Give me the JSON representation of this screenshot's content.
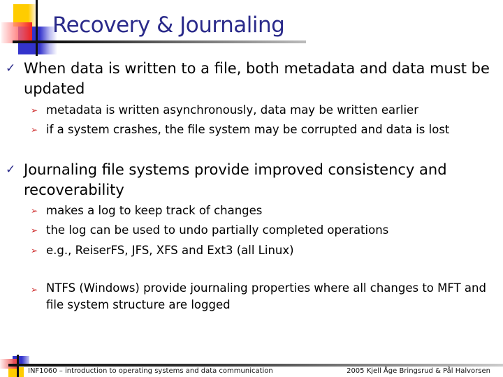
{
  "slide": {
    "title": "Recovery & Journaling",
    "bullets": [
      {
        "text": "When data is written to a file, both metadata and data must be updated",
        "sub": [
          "metadata is written asynchronously, data may be written earlier",
          "if a system crashes, the file system may be corrupted and data is lost"
        ]
      },
      {
        "text": "Journaling file systems provide improved consistency and recoverability",
        "sub": [
          "makes a log to keep track of changes",
          "the log can be used to undo partially completed operations",
          "e.g., ReiserFS, JFS, XFS and Ext3 (all Linux)",
          "NTFS (Windows) provide journaling properties where all changes to MFT and file system structure are logged"
        ]
      }
    ],
    "icons": {
      "level1_bullet": "✓",
      "level2_bullet": "➢"
    }
  },
  "footer": {
    "course": "INF1060 – introduction to operating systems and data communication",
    "credits": "2005  Kjell Åge Bringsrud & Pål Halvorsen"
  },
  "colors": {
    "title": "#2a2a8a",
    "check": "#2a2a8a",
    "arrow": "#cc2222",
    "deco_yellow": "#ffcc00",
    "deco_blue": "#3333cc",
    "deco_red": "#ee2222"
  }
}
